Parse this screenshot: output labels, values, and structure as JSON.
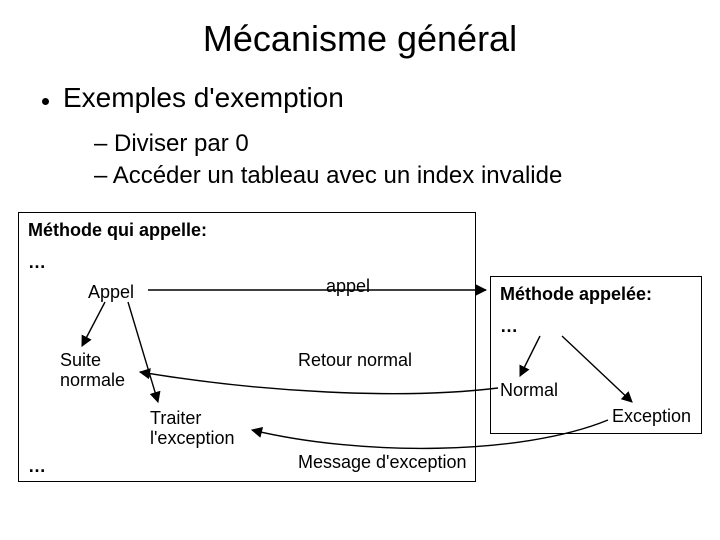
{
  "title": "Mécanisme général",
  "bullet": "Exemples d'exemption",
  "sub1": "– Diviser par 0",
  "sub2": "– Accéder un tableau avec un index invalide",
  "left_box": {
    "header": "Méthode qui appelle:",
    "ellipsis_top": "…",
    "appel": "Appel",
    "suite_normale_l1": "Suite",
    "suite_normale_l2": "normale",
    "traiter_l1": "Traiter",
    "traiter_l2": "l'exception",
    "ellipsis_bottom": "…"
  },
  "arrows": {
    "appel_label": "appel",
    "retour_normal": "Retour normal",
    "message_exception": "Message d'exception"
  },
  "right_box": {
    "header": "Méthode appelée:",
    "ellipsis": "…",
    "normal": "Normal",
    "exception": "Exception"
  }
}
